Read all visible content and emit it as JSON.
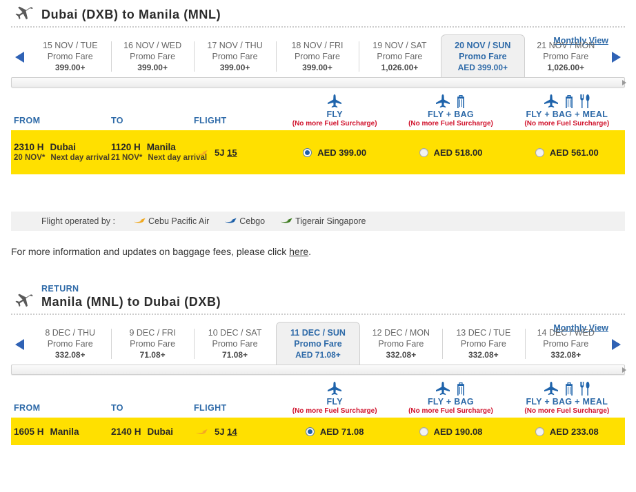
{
  "outbound": {
    "title": "Dubai  (DXB) to  Manila  (MNL)",
    "plane_icon": "airplane-icon",
    "monthly_view_label": "Monthly View",
    "prev_label": "prev-date-arrow",
    "next_label": "next-date-arrow",
    "dates": [
      {
        "date": "15 NOV / TUE",
        "fare_label": "Promo Fare",
        "fare": "399.00+",
        "selected": false
      },
      {
        "date": "16 NOV / WED",
        "fare_label": "Promo Fare",
        "fare": "399.00+",
        "selected": false
      },
      {
        "date": "17 NOV / THU",
        "fare_label": "Promo Fare",
        "fare": "399.00+",
        "selected": false
      },
      {
        "date": "18 NOV / FRI",
        "fare_label": "Promo Fare",
        "fare": "399.00+",
        "selected": false
      },
      {
        "date": "19 NOV / SAT",
        "fare_label": "Promo Fare",
        "fare": "1,026.00+",
        "selected": false
      },
      {
        "date": "20 NOV / SUN",
        "fare_label": "Promo Fare",
        "fare": "AED 399.00+",
        "selected": true
      },
      {
        "date": "21 NOV / MON",
        "fare_label": "Promo Fare",
        "fare": "1,026.00+",
        "selected": false
      }
    ],
    "columns": {
      "from": "FROM",
      "to": "TO",
      "flight": "FLIGHT"
    },
    "bundles": [
      {
        "name": "FLY",
        "note": "(No more Fuel Surcharge)",
        "icons": [
          "plane-icon"
        ]
      },
      {
        "name": "FLY + BAG",
        "note": "(No more Fuel Surcharge)",
        "icons": [
          "plane-icon",
          "bag-icon"
        ]
      },
      {
        "name": "FLY + BAG + MEAL",
        "note": "(No more Fuel Surcharge)",
        "icons": [
          "plane-icon",
          "bag-icon",
          "meal-icon"
        ]
      }
    ],
    "row": {
      "depart_time": "2310 H",
      "depart_city": "Dubai",
      "depart_date": "20 NOV*",
      "depart_note": "Next day arrival",
      "arrive_time": "1120 H",
      "arrive_city": "Manila",
      "arrive_date": "21 NOV*",
      "arrive_note": "Next day arrival",
      "flight_carrier": "5J",
      "flight_number": "15",
      "flight_icon": "cebu-pacific-plane-icon",
      "fares": [
        {
          "amount": "AED 399.00",
          "selected": true
        },
        {
          "amount": "AED 518.00",
          "selected": false
        },
        {
          "amount": "AED 561.00",
          "selected": false
        }
      ]
    }
  },
  "operated_by": {
    "label": "Flight operated by :",
    "airlines": [
      {
        "name": "Cebu Pacific Air",
        "color": "#f0a81e",
        "icon": "cebu-pacific-icon"
      },
      {
        "name": "Cebgo",
        "color": "#1c5fa8",
        "icon": "cebgo-icon"
      },
      {
        "name": "Tigerair Singapore",
        "color": "#3c7a1e",
        "icon": "tigerair-icon"
      }
    ]
  },
  "baggage_note": {
    "before": "For more information and updates on baggage fees, please click ",
    "link": "here",
    "after": "."
  },
  "return": {
    "label": "RETURN",
    "title": "Manila  (MNL) to  Dubai  (DXB)",
    "plane_icon": "airplane-icon",
    "monthly_view_label": "Monthly View",
    "dates": [
      {
        "date": "8 DEC / THU",
        "fare_label": "Promo Fare",
        "fare": "332.08+",
        "selected": false
      },
      {
        "date": "9 DEC / FRI",
        "fare_label": "Promo Fare",
        "fare": "71.08+",
        "selected": false
      },
      {
        "date": "10 DEC / SAT",
        "fare_label": "Promo Fare",
        "fare": "71.08+",
        "selected": false
      },
      {
        "date": "11 DEC / SUN",
        "fare_label": "Promo Fare",
        "fare": "AED 71.08+",
        "selected": true
      },
      {
        "date": "12 DEC / MON",
        "fare_label": "Promo Fare",
        "fare": "332.08+",
        "selected": false
      },
      {
        "date": "13 DEC / TUE",
        "fare_label": "Promo Fare",
        "fare": "332.08+",
        "selected": false
      },
      {
        "date": "14 DEC / WED",
        "fare_label": "Promo Fare",
        "fare": "332.08+",
        "selected": false
      }
    ],
    "columns": {
      "from": "FROM",
      "to": "TO",
      "flight": "FLIGHT"
    },
    "bundles": [
      {
        "name": "FLY",
        "note": "(No more Fuel Surcharge)",
        "icons": [
          "plane-icon"
        ]
      },
      {
        "name": "FLY + BAG",
        "note": "(No more Fuel Surcharge)",
        "icons": [
          "plane-icon",
          "bag-icon"
        ]
      },
      {
        "name": "FLY + BAG + MEAL",
        "note": "(No more Fuel Surcharge)",
        "icons": [
          "plane-icon",
          "bag-icon",
          "meal-icon"
        ]
      }
    ],
    "row": {
      "depart_time": "1605 H",
      "depart_city": "Manila",
      "arrive_time": "2140 H",
      "arrive_city": "Dubai",
      "flight_carrier": "5J",
      "flight_number": "14",
      "flight_icon": "cebu-pacific-plane-icon",
      "fares": [
        {
          "amount": "AED 71.08",
          "selected": true
        },
        {
          "amount": "AED 190.08",
          "selected": false
        },
        {
          "amount": "AED 233.08",
          "selected": false
        }
      ]
    }
  },
  "colors": {
    "row_yellow": "#FFE000",
    "link_blue": "#2e6aa8",
    "icon_blue": "#1e63ab",
    "note_red": "#d0112b"
  }
}
